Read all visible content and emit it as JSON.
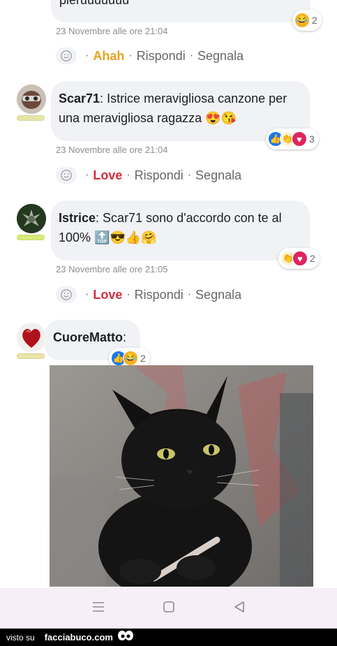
{
  "top_comment": {
    "text_fragment": "pieruuuuuuu",
    "reactions_count": "2",
    "timestamp": "23 Novembre alle ore 21:04",
    "my_reaction": "Ahah",
    "reply": "Rispondi",
    "report": "Segnala"
  },
  "comment_scar": {
    "author": "Scar71",
    "text": ": Istrice meravigliosa canzone per una meravigliosa ragazza 😍😘",
    "reactions_count": "3",
    "timestamp": "23 Novembre alle ore 21:04",
    "my_reaction": "Love",
    "reply": "Rispondi",
    "report": "Segnala"
  },
  "comment_istrice": {
    "author": "Istrice",
    "text": ": Scar71 sono d'accordo con te al 100% 🔝😎👍🤗",
    "reactions_count": "2",
    "timestamp": "23 Novembre alle ore 21:05",
    "my_reaction": "Love",
    "reply": "Rispondi",
    "report": "Segnala"
  },
  "comment_cuorematto": {
    "author": "CuoreMatto",
    "text": ":",
    "reactions_count": "2"
  },
  "footer": {
    "visto_su": "visto su",
    "brand": "facciabuco.com"
  },
  "colors": {
    "ahah": "#e8a21c",
    "love": "#d62b3b",
    "bubble": "#f0f2f5",
    "meta_text": "#8a8d91"
  }
}
